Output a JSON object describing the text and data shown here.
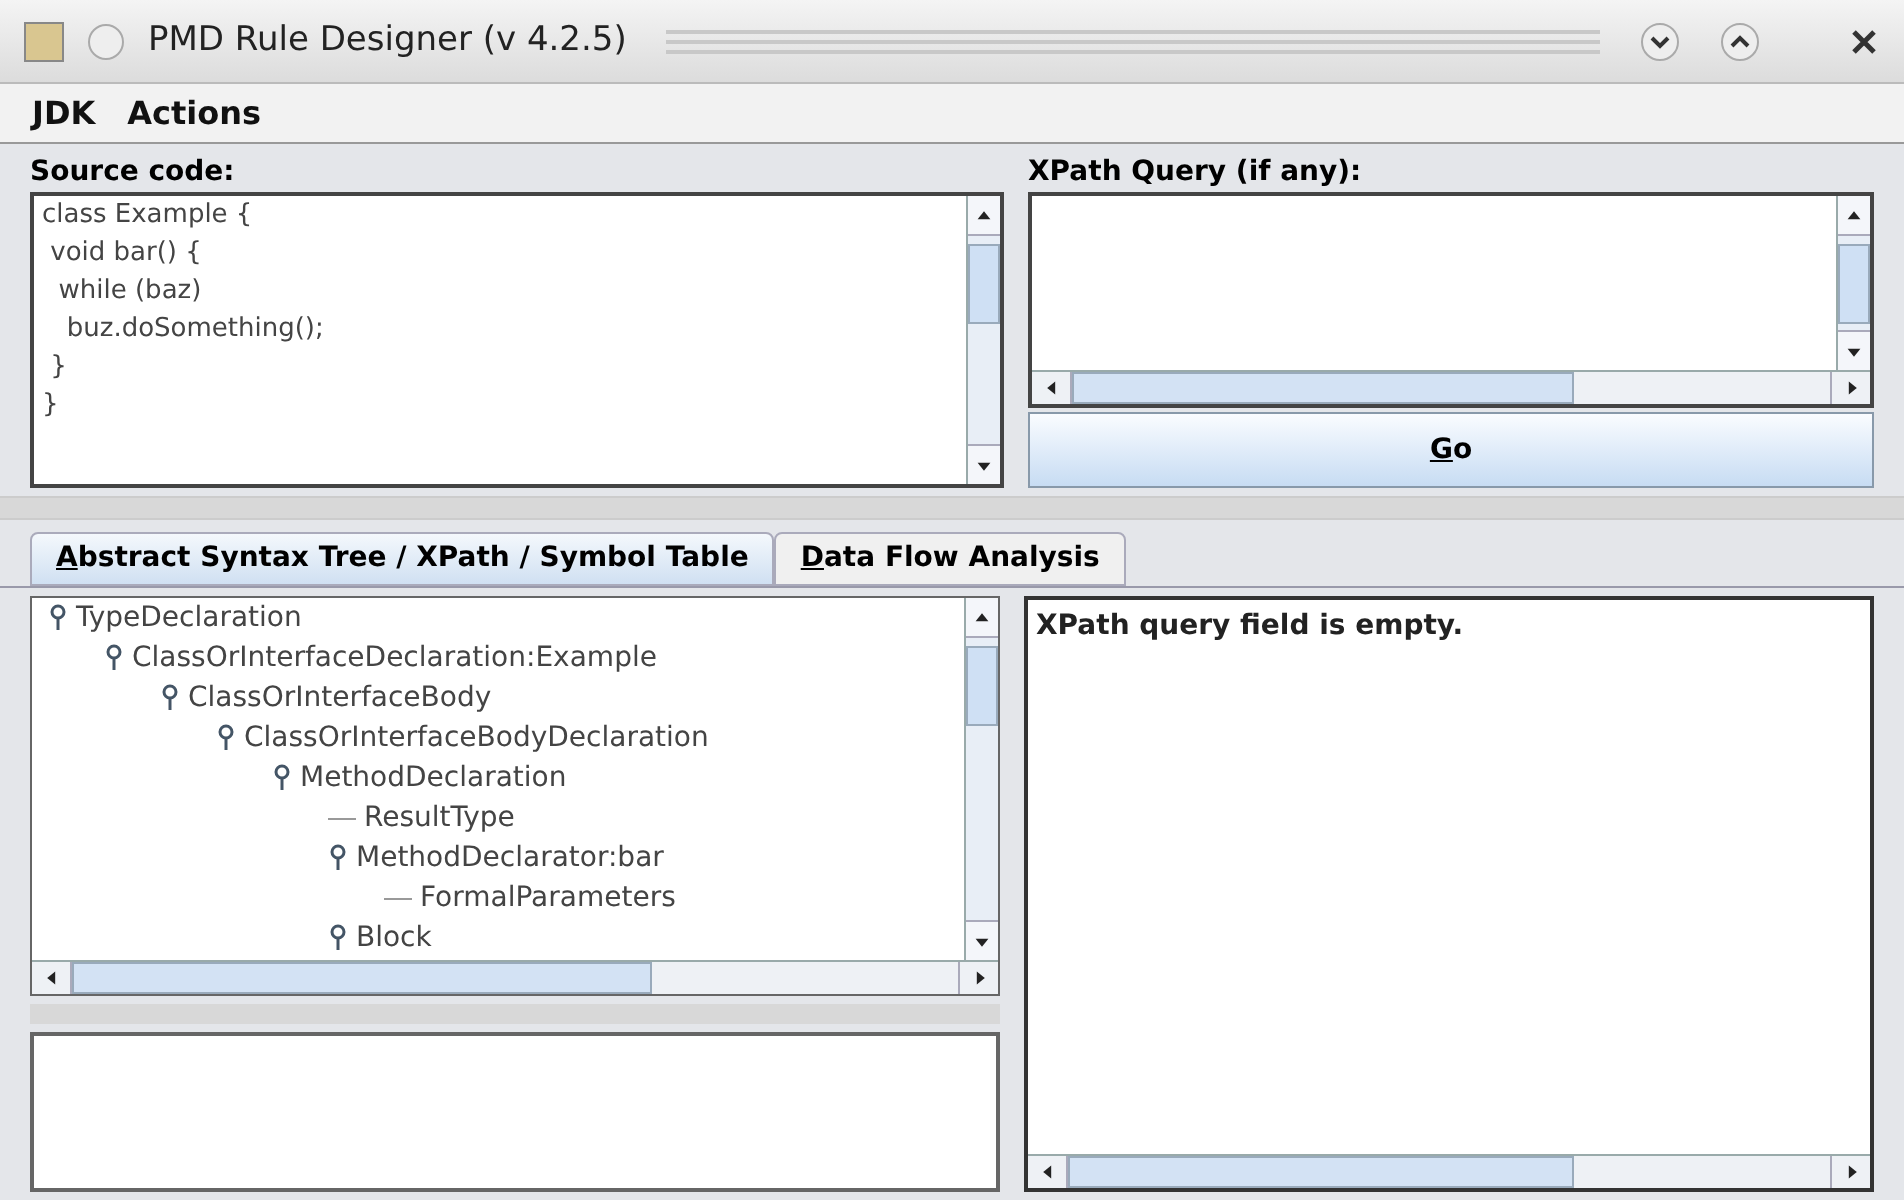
{
  "window": {
    "title": "PMD Rule Designer (v 4.2.5)"
  },
  "menu": [
    {
      "label": "JDK"
    },
    {
      "label": "Actions"
    }
  ],
  "source": {
    "label": "Source code:",
    "lines": [
      "class Example {",
      " void bar() {",
      "  while (baz)",
      "   buz.doSomething();",
      " }",
      "}"
    ]
  },
  "xpath": {
    "label": "XPath Query (if any):",
    "button": {
      "label": "Go",
      "underline_first": true
    }
  },
  "tabs": [
    {
      "label": "Abstract Syntax Tree / XPath / Symbol Table",
      "selected": true,
      "underline_first": true
    },
    {
      "label": "Data Flow Analysis",
      "selected": false,
      "underline_first": true
    }
  ],
  "tree": [
    {
      "label": "TypeDeclaration",
      "expanded": true,
      "children": [
        {
          "label": "ClassOrInterfaceDeclaration:Example",
          "expanded": true,
          "children": [
            {
              "label": "ClassOrInterfaceBody",
              "expanded": true,
              "children": [
                {
                  "label": "ClassOrInterfaceBodyDeclaration",
                  "expanded": true,
                  "children": [
                    {
                      "label": "MethodDeclaration",
                      "expanded": true,
                      "children": [
                        {
                          "label": "ResultType",
                          "expanded": false
                        },
                        {
                          "label": "MethodDeclarator:bar",
                          "expanded": true,
                          "children": [
                            {
                              "label": "FormalParameters",
                              "expanded": false
                            }
                          ]
                        },
                        {
                          "label": "Block",
                          "expanded": true
                        }
                      ]
                    }
                  ]
                }
              ]
            }
          ]
        }
      ]
    }
  ],
  "result": {
    "message": "XPath query field is empty."
  }
}
